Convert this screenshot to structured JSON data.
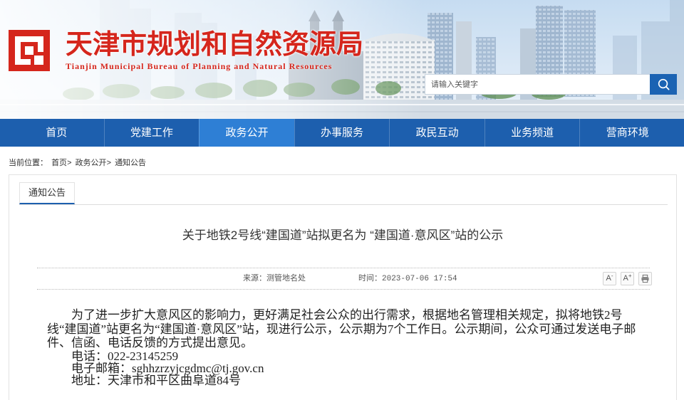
{
  "site": {
    "title": "天津市规划和自然资源局",
    "subtitle_en": "Tianjin Municipal Bureau of Planning and Natural Resources",
    "logo_icon": "bureau-logo-icon"
  },
  "search": {
    "placeholder": "请输入关键字",
    "button_icon": "search-icon"
  },
  "nav": {
    "items": [
      {
        "label": "首页",
        "active": false
      },
      {
        "label": "党建工作",
        "active": false
      },
      {
        "label": "政务公开",
        "active": true
      },
      {
        "label": "办事服务",
        "active": false
      },
      {
        "label": "政民互动",
        "active": false
      },
      {
        "label": "业务频道",
        "active": false
      },
      {
        "label": "营商环境",
        "active": false
      }
    ]
  },
  "breadcrumb": {
    "prefix": "当前位置：",
    "separator": ">",
    "items": [
      "首页",
      "政务公开",
      "通知公告"
    ]
  },
  "section": {
    "tab_label": "通知公告"
  },
  "article": {
    "title": "关于地铁2号线“建国道”站拟更名为 “建国道·意风区”站的公示",
    "source_label": "来源：",
    "source": "测管地名处",
    "time_label": "时间：",
    "time": "2023-07-06 17:54",
    "tools": {
      "font_smaller": {
        "label": "A",
        "sign": "-",
        "icon": "font-decrease-icon"
      },
      "font_larger": {
        "label": "A",
        "sign": "+",
        "icon": "font-increase-icon"
      },
      "print": {
        "icon": "printer-icon"
      }
    },
    "body": [
      "为了进一步扩大意风区的影响力，更好满足社会公众的出行需求，根据地名管理相关规定，拟将地铁2号线“建国道”站更名为“建国道·意风区”站，现进行公示，公示期为7个工作日。公示期间，公众可通过发送电子邮件、信函、电话反馈的方式提出意见。",
      "电话：022-23145259",
      "电子邮箱：sghhzrzyjcgdmc@tj.gov.cn",
      "地址：天津市和平区曲阜道84号"
    ]
  },
  "colors": {
    "brand_red": "#d5261c",
    "nav_blue": "#1d5fae",
    "nav_active": "#2e7fd5",
    "search_blue": "#1b63b3"
  }
}
